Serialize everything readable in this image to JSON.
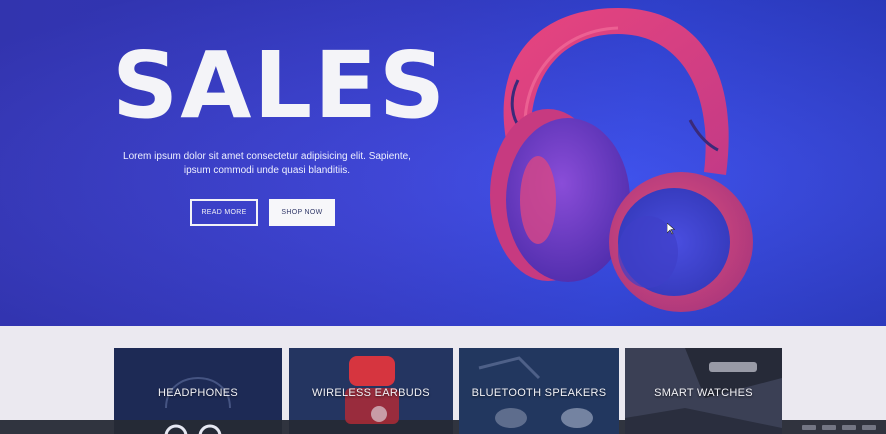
{
  "hero": {
    "title": "SALES",
    "text": "Lorem ipsum dolor sit amet consectetur adipisicing elit. Sapiente, ipsum commodi unde quasi blanditiis.",
    "read_more_label": "READ MORE",
    "shop_now_label": "SHOP NOW",
    "product_image": "headphones-image"
  },
  "categories": [
    {
      "label": "HEADPHONES"
    },
    {
      "label": "WIRELESS EARBUDS"
    },
    {
      "label": "BLUETOOTH SPEAKERS"
    },
    {
      "label": "SMART WATCHES"
    }
  ],
  "colors": {
    "hero_background": "#3a42e0",
    "headphone_pink": "#e0457a",
    "headphone_violet": "#6a3fc8",
    "button_text_light": "#f2f2f7"
  }
}
